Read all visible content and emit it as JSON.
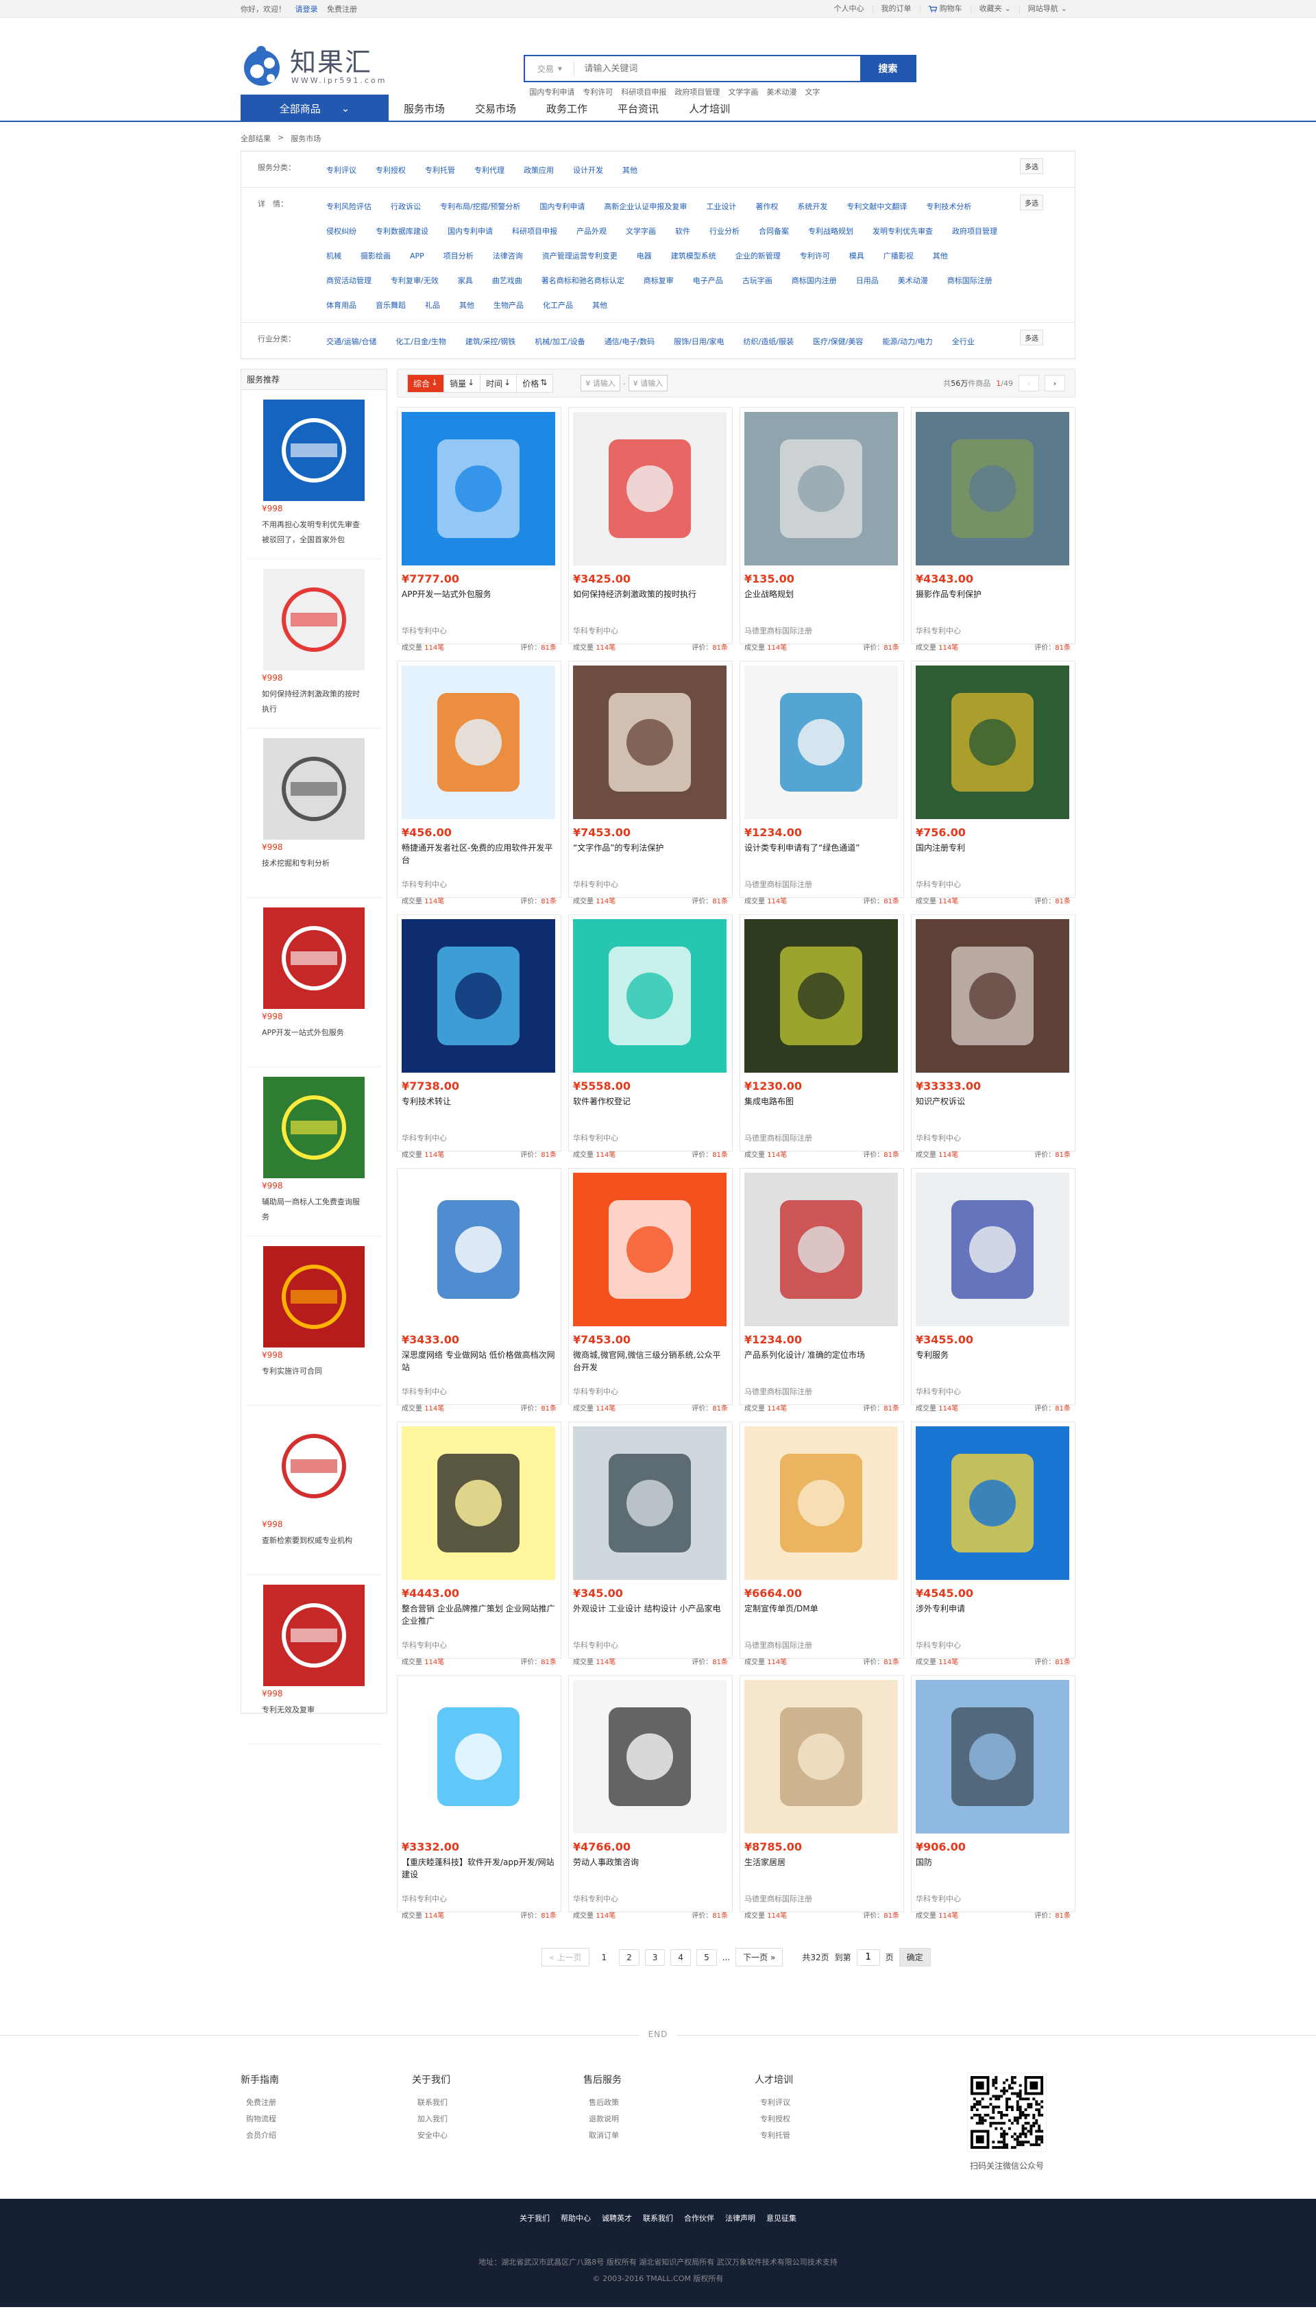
{
  "topbar": {
    "welcome": "你好，欢迎！",
    "login": "请登录",
    "register": "免费注册",
    "user_center": "个人中心",
    "my_orders": "我的订单",
    "cart": "购物车",
    "favorites": "收藏夹",
    "site_nav": "网站导航"
  },
  "logo": {
    "cn": "知果汇",
    "en": "WWW.ipr591.com"
  },
  "search": {
    "category": "交易",
    "placeholder": "请输入关键词",
    "button": "搜索",
    "hot": [
      "国内专利申请",
      "专利许可",
      "科研项目申报",
      "政府项目管理",
      "文学字画",
      "美术动漫",
      "文字"
    ]
  },
  "nav": {
    "all": "全部商品",
    "links": [
      "服务市场",
      "交易市场",
      "政务工作",
      "平台资讯",
      "人才培训"
    ]
  },
  "breadcrumb": [
    "全部结果",
    "服务市场"
  ],
  "filters": [
    {
      "label": "服务分类：",
      "values": [
        "专利评议",
        "专利授权",
        "专利托管",
        "专利代理",
        "政策应用",
        "设计开发",
        "其他"
      ],
      "more": "多选"
    },
    {
      "label": "详　情：",
      "values": [
        "专利风险评估",
        "行政诉讼",
        "专利布局/挖掘/预警分析",
        "国内专利申请",
        "高新企业认证申报及复审",
        "工业设计",
        "著作权",
        "系统开发",
        "专利文献中文翻译",
        "专利技术分析",
        "侵权纠纷",
        "专利数据库建设",
        "国内专利申请",
        "科研项目申报",
        "产品外观",
        "文学字画",
        "软件",
        "行业分析",
        "合同备案",
        "专利战略规划",
        "发明专利优先审查",
        "政府项目管理",
        "机械",
        "摄影绘画",
        "APP",
        "项目分析",
        "法律咨询",
        "资产管理运营专利变更",
        "电器",
        "建筑模型系统",
        "企业的新管理",
        "专利许可",
        "模具",
        "广播影视",
        "其他",
        "商贸活动管理",
        "专利复审/无效",
        "家具",
        "曲艺戏曲",
        "著名商标和驰名商标认定",
        "商标复审",
        "电子产品",
        "古玩字画",
        "商标国内注册",
        "日用品",
        "美术动漫",
        "商标国际注册",
        "体育用品",
        "音乐舞蹈",
        "礼品",
        "其他",
        "生物产品",
        "化工产品",
        "其他"
      ],
      "more": "多选"
    },
    {
      "label": "行业分类：",
      "values": [
        "交通/运输/仓储",
        "化工/日金/生物",
        "建筑/采控/钢铁",
        "机械/加工/设备",
        "通信/电子/数码",
        "服饰/日用/家电",
        "纺织/造纸/服装",
        "医疗/保健/美容",
        "能源/动力/电力",
        "全行业"
      ],
      "more": "多选"
    }
  ],
  "sidebar": {
    "title": "服务推荐",
    "items": [
      {
        "price": "¥998",
        "title": "不用再担心发明专利优先审查被驳回了，全国首家外包"
      },
      {
        "price": "¥998",
        "title": "如何保持经济刺激政策的按时执行"
      },
      {
        "price": "¥998",
        "title": "技术挖掘和专利分析"
      },
      {
        "price": "¥998",
        "title": "APP开发一站式外包服务"
      },
      {
        "price": "¥998",
        "title": "辅助局一商标人工免费查询服务"
      },
      {
        "price": "¥998",
        "title": "专利实施许可合同"
      },
      {
        "price": "¥998",
        "title": "查新检索要到权威专业机构"
      },
      {
        "price": "¥998",
        "title": "专利无效及复审"
      }
    ]
  },
  "sort": {
    "tabs": [
      "综合",
      "销量",
      "时间",
      "价格"
    ],
    "price_from": "¥ 请输入",
    "price_to": "¥ 请输入",
    "total_prefix": "共",
    "total": "56万",
    "total_suffix": "件商品",
    "page": "1",
    "pages": "/49"
  },
  "products": [
    {
      "price": "¥7777.00",
      "title": "APP开发一站式外包服务",
      "shop": "华科专利中心",
      "deals": "114笔",
      "rating": "81条"
    },
    {
      "price": "¥3425.00",
      "title": "如何保持经济刺激政策的按时执行",
      "shop": "华科专利中心",
      "deals": "114笔",
      "rating": "81条"
    },
    {
      "price": "¥135.00",
      "title": "企业战略规划",
      "shop": "马德里商标国际注册",
      "deals": "114笔",
      "rating": "81条"
    },
    {
      "price": "¥4343.00",
      "title": "摄影作品专利保护",
      "shop": "华科专利中心",
      "deals": "114笔",
      "rating": "81条"
    },
    {
      "price": "¥456.00",
      "title": "畅捷通开发者社区-免费的应用软件开发平台",
      "shop": "华科专利中心",
      "deals": "114笔",
      "rating": "81条"
    },
    {
      "price": "¥7453.00",
      "title": "“文字作品”的专利法保护",
      "shop": "华科专利中心",
      "deals": "114笔",
      "rating": "81条"
    },
    {
      "price": "¥1234.00",
      "title": "设计类专利申请有了“绿色通道”",
      "shop": "马德里商标国际注册",
      "deals": "114笔",
      "rating": "81条"
    },
    {
      "price": "¥756.00",
      "title": "国内注册专利",
      "shop": "华科专利中心",
      "deals": "114笔",
      "rating": "81条"
    },
    {
      "price": "¥7738.00",
      "title": "专利技术转让",
      "shop": "华科专利中心",
      "deals": "114笔",
      "rating": "81条"
    },
    {
      "price": "¥5558.00",
      "title": "软件著作权登记",
      "shop": "华科专利中心",
      "deals": "114笔",
      "rating": "81条"
    },
    {
      "price": "¥1230.00",
      "title": "集成电路布图",
      "shop": "马德里商标国际注册",
      "deals": "114笔",
      "rating": "81条"
    },
    {
      "price": "¥33333.00",
      "title": "知识产权诉讼",
      "shop": "华科专利中心",
      "deals": "114笔",
      "rating": "81条"
    },
    {
      "price": "¥3433.00",
      "title": "深思度网络 专业做网站 低价格做高档次网站",
      "shop": "华科专利中心",
      "deals": "114笔",
      "rating": "81条"
    },
    {
      "price": "¥7453.00",
      "title": "微商城,微官网,微信三级分销系统,公众平台开发",
      "shop": "华科专利中心",
      "deals": "114笔",
      "rating": "81条"
    },
    {
      "price": "¥1234.00",
      "title": "产品系列化设计/ 准确的定位市场",
      "shop": "马德里商标国际注册",
      "deals": "114笔",
      "rating": "81条"
    },
    {
      "price": "¥3455.00",
      "title": "专利服务",
      "shop": "华科专利中心",
      "deals": "114笔",
      "rating": "81条"
    },
    {
      "price": "¥4443.00",
      "title": "整合营销 企业品牌推广策划 企业网站推广 企业推广",
      "shop": "华科专利中心",
      "deals": "114笔",
      "rating": "81条"
    },
    {
      "price": "¥345.00",
      "title": "外观设计 工业设计 结构设计 小产品家电",
      "shop": "华科专利中心",
      "deals": "114笔",
      "rating": "81条"
    },
    {
      "price": "¥6664.00",
      "title": "定制宣传单页/DM单",
      "shop": "马德里商标国际注册",
      "deals": "114笔",
      "rating": "81条"
    },
    {
      "price": "¥4545.00",
      "title": "涉外专利申请",
      "shop": "华科专利中心",
      "deals": "114笔",
      "rating": "81条"
    },
    {
      "price": "¥3332.00",
      "title": "【重庆睦蓬科技】软件开发/app开发/网站建设",
      "shop": "华科专利中心",
      "deals": "114笔",
      "rating": "81条"
    },
    {
      "price": "¥4766.00",
      "title": "劳动人事政策咨询",
      "shop": "华科专利中心",
      "deals": "114笔",
      "rating": "81条"
    },
    {
      "price": "¥8785.00",
      "title": "生活家居居",
      "shop": "马德里商标国际注册",
      "deals": "114笔",
      "rating": "81条"
    },
    {
      "price": "¥906.00",
      "title": "国防",
      "shop": "华科专利中心",
      "deals": "114笔",
      "rating": "81条"
    }
  ],
  "card_labels": {
    "deals_prefix": "成交量",
    "rating_prefix": "评价："
  },
  "pager": {
    "prev": "« 上一页",
    "pages": [
      "1",
      "2",
      "3",
      "4",
      "5"
    ],
    "ellipsis": "...",
    "next": "下一页 »",
    "total": "共32页",
    "goto": "到第",
    "goto_value": "1",
    "page_unit": "页",
    "confirm": "确定"
  },
  "end_label": "END",
  "footer": {
    "cols": [
      {
        "title": "新手指南",
        "items": [
          "免费注册",
          "购物流程",
          "会员介绍"
        ]
      },
      {
        "title": "关于我们",
        "items": [
          "联系我们",
          "加入我们",
          "安全中心"
        ]
      },
      {
        "title": "售后服务",
        "items": [
          "售后政策",
          "退款说明",
          "取消订单"
        ]
      },
      {
        "title": "人才培训",
        "items": [
          "专利评议",
          "专利授权",
          "专利托管"
        ]
      }
    ],
    "qr_caption": "扫码关注微信公众号",
    "bottom_links": [
      "关于我们",
      "帮助中心",
      "诚聘英才",
      "联系我们",
      "合作伙伴",
      "法律声明",
      "意见征集"
    ],
    "address": "地址：湖北省武汉市武昌区广八路8号 版权所有 湖北省知识产权局所有 武汉万象软件技术有限公司技术支持",
    "copyright": "© 2003-2016 TMALL.COM 版权所有"
  },
  "colors": {
    "brand": "#2358b0",
    "price": "#e4391b",
    "footer_bg": "#161f33"
  }
}
